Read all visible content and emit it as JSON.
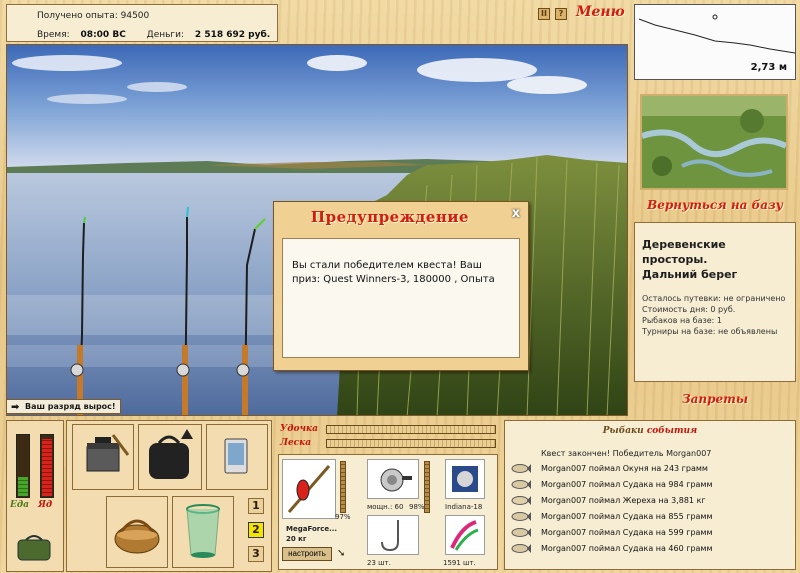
{
  "info": {
    "exp_label": "Получено опыта:",
    "exp_value": "94500",
    "time_label": "Время:",
    "time_value": "08:00 ВС",
    "money_label": "Деньги:",
    "money_value": "2 518 692 руб."
  },
  "top_controls": {
    "pause": "II",
    "help": "?",
    "menu": "Меню"
  },
  "notification": "Ваш разряд вырос!",
  "depth": {
    "value": "2,73 м"
  },
  "right_panel": {
    "back_to_base": "Вернуться на базу",
    "location_line1": "Деревенские просторы.",
    "location_line2": "Дальний берег",
    "info_lines": [
      "Осталось путевки: не ограничено",
      "Стоимость дня: 0 руб.",
      "Рыбаков на базе: 1",
      "Турниры на базе: не объявлены"
    ],
    "bans": "Запреты"
  },
  "meters": {
    "food_label": "Еда",
    "vodka_label": "Яд",
    "food_level": 0.3,
    "vodka_level": 0.92
  },
  "tabs": [
    "1",
    "2",
    "3"
  ],
  "active_tab": "2",
  "rod_panel": {
    "rod_label": "Удочка",
    "line_label": "Леска",
    "rod_name": "MegaForce...",
    "rod_weight": "20 кг",
    "rod_condition": "97%",
    "reel_label": "мощн.: 60",
    "reel_condition": "98%",
    "line_name": "Indiana-18",
    "hooks_count": "23 шт.",
    "bait_count": "1591 шт.",
    "setup_button": "настроить"
  },
  "events": {
    "title_part1": "Рыбаки",
    "title_part2": "события",
    "quest_line": "Квест закончен! Победитель Morgan007",
    "rows": [
      "Morgan007 поймал Окуня на 243 грамм",
      "Morgan007 поймал Судака на 984 грамм",
      "Morgan007 поймал Жереха на 3,881 кг",
      "Morgan007 поймал Судака на 855 грамм",
      "Morgan007 поймал Судака на 599 грамм",
      "Morgan007 поймал Судака на 460 грамм"
    ]
  },
  "dialog": {
    "title": "Предупреждение",
    "close": "x",
    "message": "Вы стали победителем квеста! Ваш приз: Quest Winners-3, 180000 , Опыта"
  }
}
